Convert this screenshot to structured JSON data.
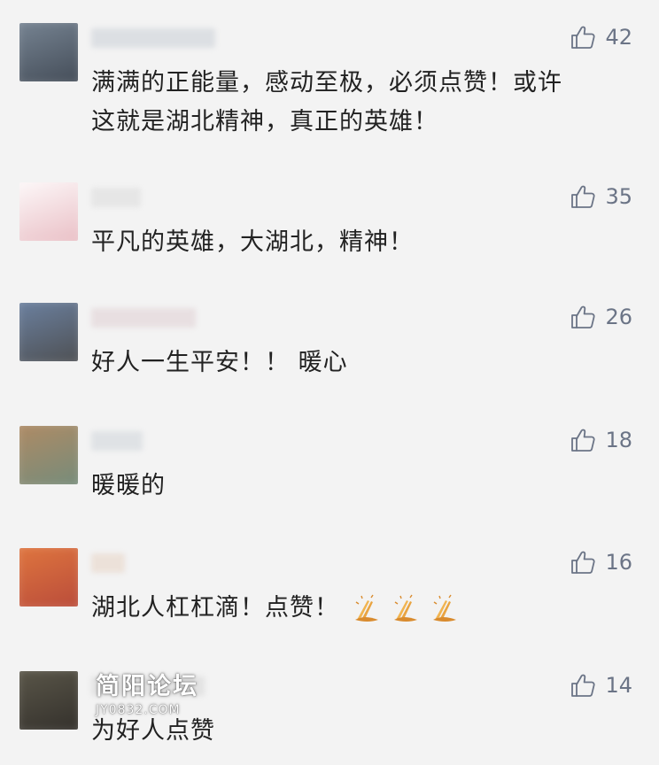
{
  "comments": [
    {
      "avatar_colors": [
        "#7c8a99",
        "#3e4651"
      ],
      "nickname_color": "#dcdfe3",
      "text": "满满的正能量，感动至极，必须点赞！或许\n这就是湖北精神，真正的英雄！",
      "likes": "42"
    },
    {
      "avatar_colors": [
        "#ffffff",
        "#e7b8bf"
      ],
      "nickname_color": "#e6e6e6",
      "text": "平凡的英雄，大湖北，精神！",
      "likes": "35"
    },
    {
      "avatar_colors": [
        "#6f86a8",
        "#4a4a4a"
      ],
      "nickname_color": "#e8dfe1",
      "text": "好人一生平安！！ 暖心",
      "likes": "26"
    },
    {
      "avatar_colors": [
        "#b58a62",
        "#6f8c7d"
      ],
      "nickname_color": "#dfe2e5",
      "text": "暖暖的",
      "likes": "18"
    },
    {
      "avatar_colors": [
        "#e37a3f",
        "#b5473a"
      ],
      "nickname_color": "#ece1d9",
      "text": "湖北人杠杠滴！点赞！",
      "emoji": [
        "clap-hands-icon",
        "clap-hands-icon",
        "clap-hands-icon"
      ],
      "likes": "16"
    },
    {
      "avatar_colors": [
        "#5e5a4c",
        "#2f2c28"
      ],
      "nickname_color": "#e2e2e2",
      "text": "为好人点赞",
      "likes": "14"
    }
  ],
  "watermark": {
    "title": "简阳论坛",
    "url": "JY0832.COM"
  },
  "colors": {
    "background": "#f3f3f3",
    "text": "#222222",
    "like": "#6b7486",
    "emoji": "#e9a441"
  }
}
